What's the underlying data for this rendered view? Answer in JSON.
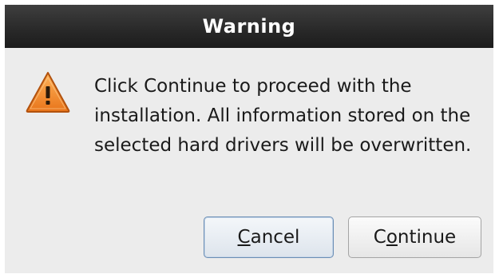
{
  "dialog": {
    "title": "Warning",
    "icon": "warning-triangle-icon",
    "message": "Click Continue to proceed with the installation. All information stored on the selected hard drivers will be overwritten.",
    "buttons": {
      "cancel": {
        "label_pre": "",
        "mnemonic": "C",
        "label_post": "ancel"
      },
      "continue": {
        "label_pre": "C",
        "mnemonic": "o",
        "label_post": "ntinue"
      }
    }
  },
  "colors": {
    "titlebar": "#2a2a2a",
    "background": "#ececec",
    "warning_orange": "#f08a24"
  }
}
